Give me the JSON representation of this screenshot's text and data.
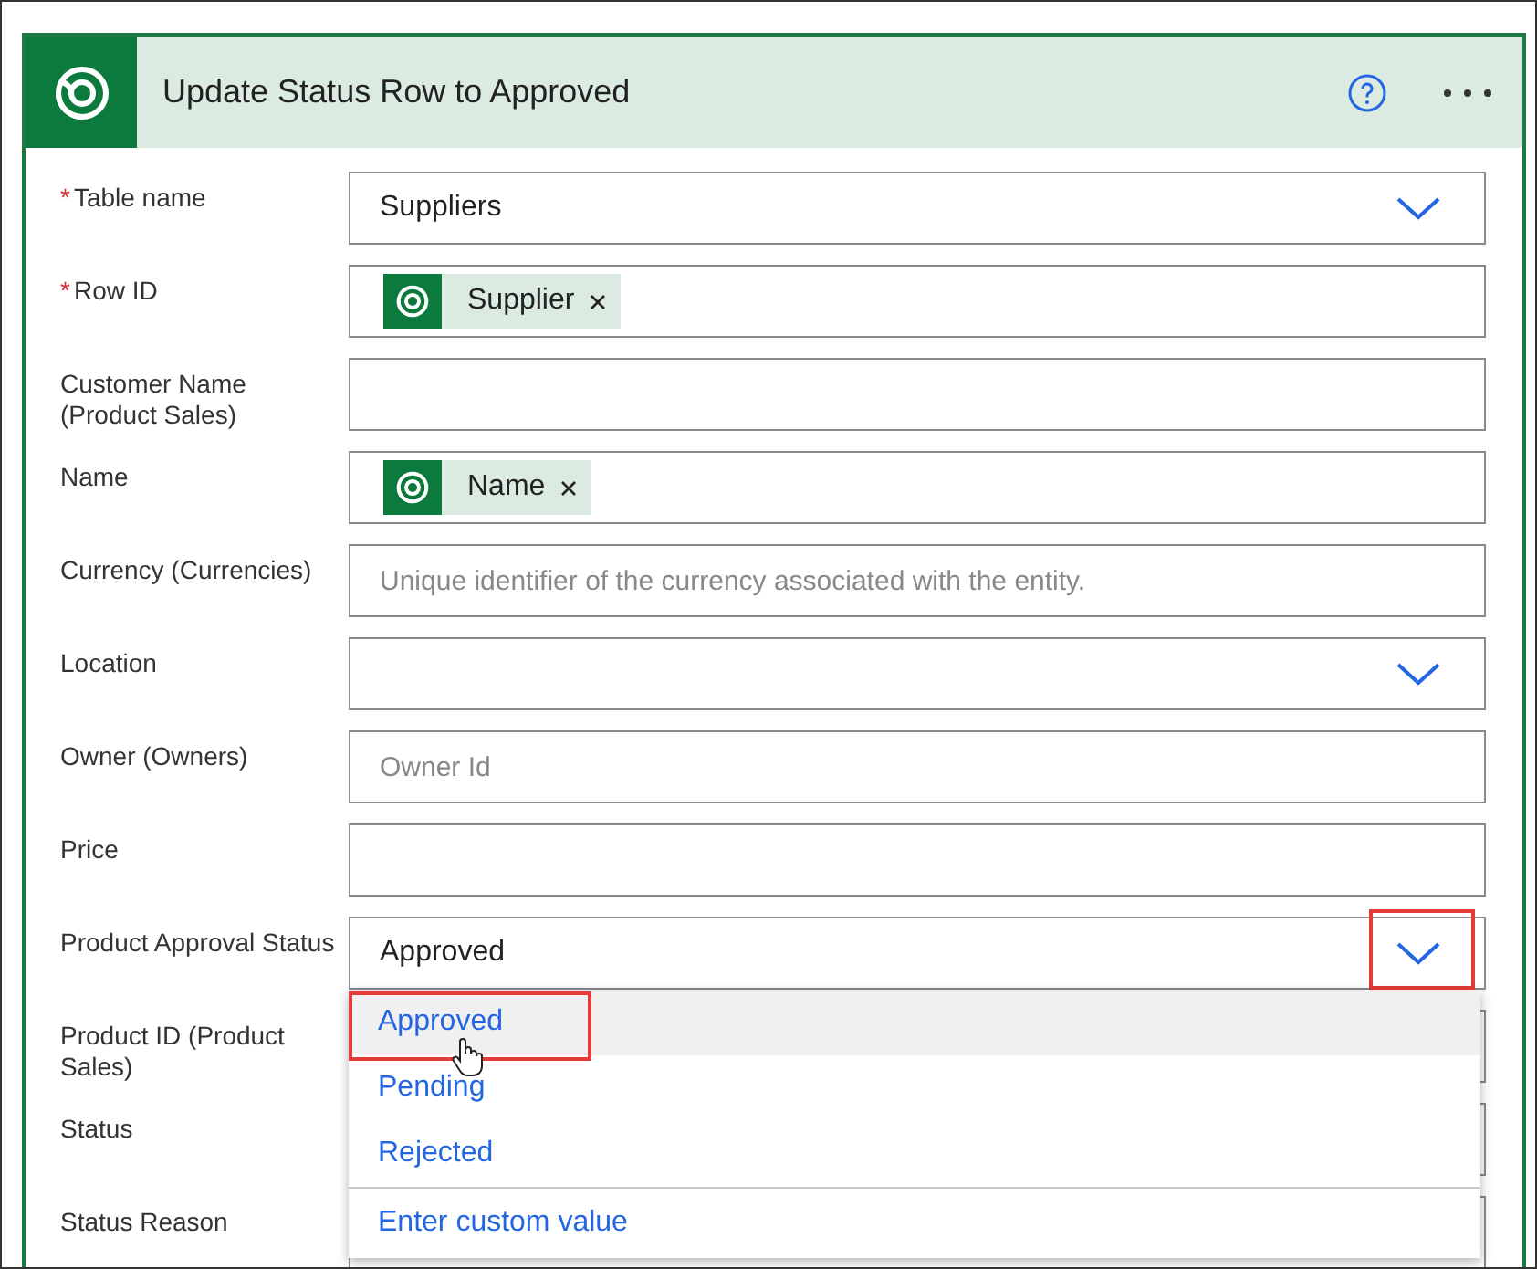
{
  "card": {
    "title": "Update Status Row to Approved"
  },
  "fields": [
    {
      "label": "Table name",
      "required_mark": "*",
      "kind": "dropdown",
      "value": "Suppliers"
    },
    {
      "label": "Row ID",
      "required_mark": "*",
      "kind": "token",
      "token": "Supplier"
    },
    {
      "label": "Customer Name (Product Sales)",
      "kind": "text"
    },
    {
      "label": "Name",
      "kind": "token",
      "token": "Name"
    },
    {
      "label": "Currency (Currencies)",
      "kind": "text",
      "placeholder": "Unique identifier of the currency associated with the entity."
    },
    {
      "label": "Location",
      "kind": "dropdown"
    },
    {
      "label": "Owner (Owners)",
      "kind": "text",
      "placeholder": "Owner Id"
    },
    {
      "label": "Price",
      "kind": "text"
    },
    {
      "label": "Product Approval Status",
      "kind": "dropdown",
      "value": "Approved",
      "chevron_annotated": true,
      "open": true
    },
    {
      "label": "Product ID (Product Sales)",
      "kind": "text"
    },
    {
      "label": "Status",
      "kind": "text"
    },
    {
      "label": "Status Reason",
      "kind": "text"
    }
  ],
  "dropdown_options": [
    {
      "label": "Approved",
      "selected": true,
      "annotated": true
    },
    {
      "label": "Pending",
      "selected": false,
      "annotated": false
    },
    {
      "label": "Rejected",
      "selected": false,
      "annotated": false
    }
  ],
  "custom_value": "Enter custom value"
}
